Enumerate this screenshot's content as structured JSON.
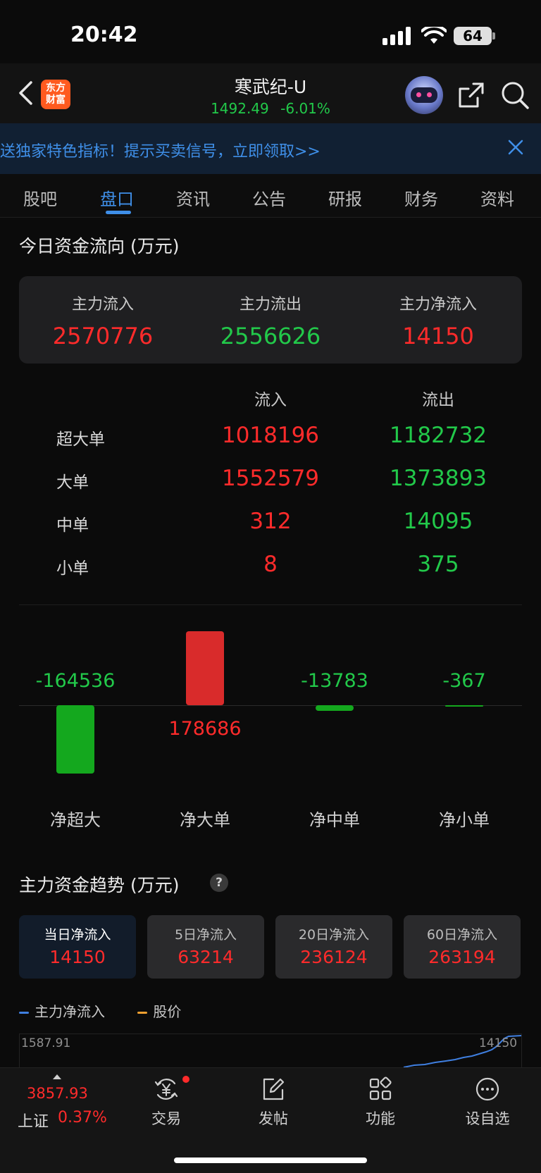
{
  "status_bar": {
    "time": "20:42",
    "battery": "64"
  },
  "header": {
    "logo_line1": "东方",
    "logo_line2": "财富",
    "stock_name": "寒武纪-U",
    "price": "1492.49",
    "change_pct": "-6.01%"
  },
  "banner": {
    "text": "送独家特色指标！提示买卖信号，立即领取>>"
  },
  "tabs": [
    {
      "label": "股吧"
    },
    {
      "label": "盘口"
    },
    {
      "label": "资讯"
    },
    {
      "label": "公告"
    },
    {
      "label": "研报"
    },
    {
      "label": "财务"
    },
    {
      "label": "资料"
    }
  ],
  "money_flow": {
    "title": "今日资金流向 (万元)",
    "summary": [
      {
        "label": "主力流入",
        "value": "2570776"
      },
      {
        "label": "主力流出",
        "value": "2556626"
      },
      {
        "label": "主力净流入",
        "value": "14150"
      }
    ],
    "column_headers": {
      "inflow": "流入",
      "outflow": "流出"
    },
    "rows": [
      {
        "label": "超大单",
        "inflow": "1018196",
        "outflow": "1182732"
      },
      {
        "label": "大单",
        "inflow": "1552579",
        "outflow": "1373893"
      },
      {
        "label": "中单",
        "inflow": "312",
        "outflow": "14095"
      },
      {
        "label": "小单",
        "inflow": "8",
        "outflow": "375"
      }
    ]
  },
  "chart_data": {
    "type": "bar",
    "categories": [
      "净超大",
      "净大单",
      "净中单",
      "净小单"
    ],
    "values": [
      -164536,
      178686,
      -13783,
      -367
    ],
    "value_labels": [
      "-164536",
      "178686",
      "-13783",
      "-367"
    ],
    "colors": {
      "positive": "#d92b2b",
      "negative": "#14a81e"
    }
  },
  "trend": {
    "title": "主力资金趋势 (万元)",
    "help_symbol": "?",
    "cards": [
      {
        "label": "当日净流入",
        "value": "14150"
      },
      {
        "label": "5日净流入",
        "value": "63214"
      },
      {
        "label": "20日净流入",
        "value": "236124"
      },
      {
        "label": "60日净流入",
        "value": "263194"
      }
    ],
    "legend": [
      {
        "label": "主力净流入",
        "color": "#3f7fe0"
      },
      {
        "label": "股价",
        "color": "#f0a030"
      }
    ],
    "y_max_label": "1587.91",
    "latest_label": "14150"
  },
  "bottom_nav": {
    "index_value": "3857.93",
    "index_name": "上证",
    "index_change": "0.37%",
    "items": [
      {
        "label": "交易",
        "icon": "yen-trade-icon"
      },
      {
        "label": "发帖",
        "icon": "edit-post-icon"
      },
      {
        "label": "功能",
        "icon": "function-grid-icon"
      },
      {
        "label": "设自选",
        "icon": "more-dots-icon"
      }
    ]
  }
}
